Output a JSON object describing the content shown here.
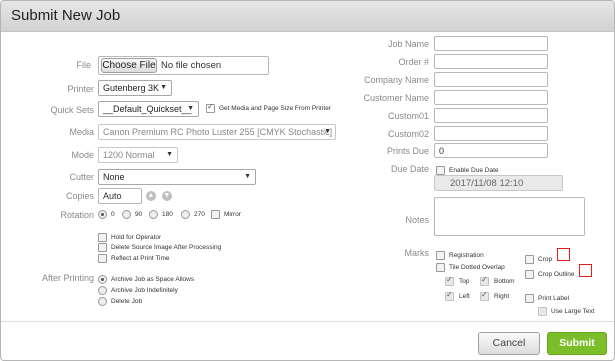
{
  "dialog": {
    "title": "Submit New Job"
  },
  "file": {
    "label": "File",
    "button": "Choose File",
    "value": "No file chosen"
  },
  "printer": {
    "label": "Printer",
    "value": "Gutenberg 3K"
  },
  "quick_sets": {
    "label": "Quick Sets",
    "value": "__Default_Quickset__",
    "get_media_label": "Get Media and Page Size From Printer",
    "get_media_checked": true
  },
  "media": {
    "label": "Media",
    "value": "Canon Premium RC Photo Luster 255 [CMYK Stochastic]"
  },
  "mode": {
    "label": "Mode",
    "value": "1200 Normal"
  },
  "cutter": {
    "label": "Cutter",
    "value": "None"
  },
  "copies": {
    "label": "Copies",
    "value": "Auto",
    "up_icon": "arrow-up-circle",
    "down_icon": "arrow-down-circle"
  },
  "rotation": {
    "label": "Rotation",
    "options": [
      "0",
      "90",
      "180",
      "270"
    ],
    "selected": "0",
    "mirror_label": "Mirror"
  },
  "options": {
    "hold_label": "Hold for Operator",
    "delete_label": "Delete Source Image After Processing",
    "reflect_label": "Reflect at Print Time"
  },
  "after_printing": {
    "label": "After Printing",
    "options": [
      "Archive Job as Space Allows",
      "Archive Job Indefinitely",
      "Delete Job"
    ],
    "selected": "Archive Job as Space Allows"
  },
  "right_fields": {
    "job_name": {
      "label": "Job Name",
      "value": ""
    },
    "order": {
      "label": "Order #",
      "value": ""
    },
    "company": {
      "label": "Company Name",
      "value": ""
    },
    "customer": {
      "label": "Customer Name",
      "value": ""
    },
    "custom01": {
      "label": "Custom01",
      "value": ""
    },
    "custom02": {
      "label": "Custom02",
      "value": ""
    },
    "prints_due": {
      "label": "Prints Due",
      "value": "0"
    }
  },
  "due_date": {
    "label": "Due Date",
    "enable_label": "Enable Due Date",
    "value": "2017/11/08 12:10"
  },
  "notes": {
    "label": "Notes",
    "value": ""
  },
  "marks": {
    "label": "Marks",
    "registration": "Registration",
    "tile_dotted": "Tile Dotted Overlap",
    "top": "Top",
    "bottom": "Bottom",
    "left": "Left",
    "right": "Right",
    "crop": "Crop",
    "crop_outline": "Crop Outline",
    "print_label": "Print Label",
    "use_large_text": "Use Large Text",
    "crop_indicator_color": "#e21b1b"
  },
  "footer": {
    "cancel": "Cancel",
    "submit": "Submit",
    "submit_color": "#7cbd2a"
  }
}
